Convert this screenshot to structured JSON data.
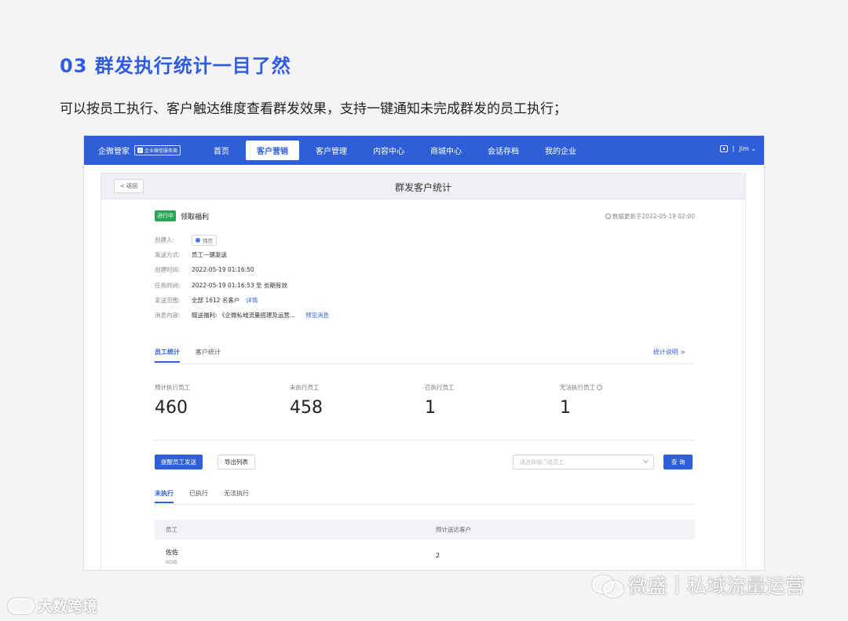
{
  "section": {
    "title": "03  群发执行统计一目了然",
    "description": "可以按员工执行、客户触达维度查看群发效果，支持一键通知未完成群发的员工执行；"
  },
  "topnav": {
    "brand": "企微管家",
    "brand_tag": "企业微信服务商",
    "items": [
      "首页",
      "客户营销",
      "客户管理",
      "内容中心",
      "商城中心",
      "会话存档",
      "我的企业"
    ],
    "active_item": "客户营销",
    "user": "Jim",
    "separator": "|"
  },
  "panel": {
    "back_label": "< 返回",
    "title": "群发客户统计"
  },
  "task": {
    "status_badge": "进行中",
    "name": "领取福利",
    "updated": "数据更新于2022-05-19 02:00",
    "creator_label": "创建人:",
    "creator": "玮杰",
    "send_method_label": "发送方式:",
    "send_method": "员工一键发送",
    "created_label": "创建时间:",
    "created": "2022-05-19 01:16:50",
    "duration_label": "任务时间:",
    "duration": "2022-05-19 01:16:53 至 长期有效",
    "range_label": "发送范围:",
    "range": "全部 1612 名客户",
    "range_link": "详情",
    "content_label": "消息内容:",
    "content": "赠送福利: 《企微私域流量搭建及运营...",
    "content_link": "预览消息"
  },
  "tabs1": {
    "items": [
      "员工统计",
      "客户统计"
    ],
    "active": "员工统计",
    "right_link": "统计说明 >"
  },
  "stats": [
    {
      "label": "预计执行员工",
      "value": "460"
    },
    {
      "label": "未执行员工",
      "value": "458"
    },
    {
      "label": "已执行员工",
      "value": "1"
    },
    {
      "label": "无法执行员工",
      "value": "1"
    }
  ],
  "actions": {
    "remind_btn": "提醒员工发送",
    "export_btn": "导出列表",
    "select_placeholder": "请选择部门或员工",
    "query_btn": "查 询"
  },
  "tabs2": {
    "items": [
      "未执行",
      "已执行",
      "无法执行"
    ],
    "active": "未执行"
  },
  "table": {
    "headers": [
      "员工",
      "预计送达客户"
    ],
    "rows": [
      {
        "name": "佐佐",
        "dept": "BD组",
        "count": "2"
      }
    ]
  },
  "watermarks": {
    "left": "大数跨境",
    "right": "微盛丨私域流量运营"
  },
  "colors": {
    "accent": "#2f5fd8",
    "title_blue": "#2f5ce0",
    "badge_green": "#26a655"
  }
}
